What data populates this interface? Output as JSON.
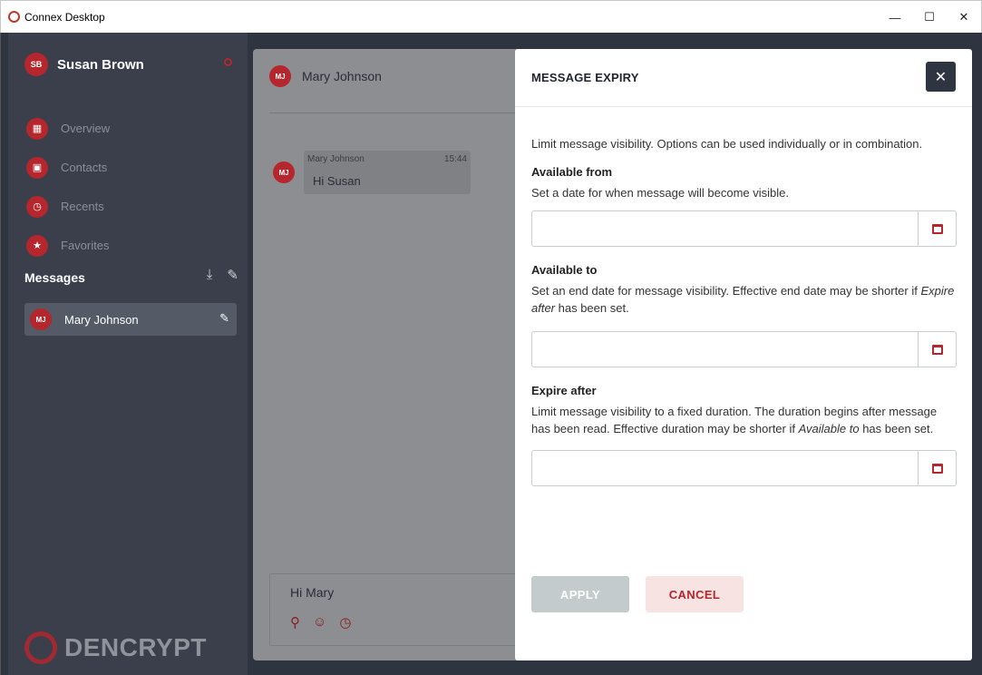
{
  "window": {
    "title": "Connex Desktop",
    "controls": {
      "minimize": "—",
      "maximize": "☐",
      "close": "✕"
    }
  },
  "sidebar": {
    "user": {
      "initials": "SB",
      "name": "Susan Brown"
    },
    "nav": [
      {
        "label": "Overview",
        "icon": "grid-icon",
        "glyph": "▦"
      },
      {
        "label": "Contacts",
        "icon": "contacts-icon",
        "glyph": "▣"
      },
      {
        "label": "Recents",
        "icon": "clock-icon",
        "glyph": "◷"
      },
      {
        "label": "Favorites",
        "icon": "star-icon",
        "glyph": "★"
      }
    ],
    "messages_title": "Messages",
    "threads": [
      {
        "initials": "MJ",
        "name": "Mary Johnson"
      }
    ],
    "logo_text": "DENCRYPT"
  },
  "chat": {
    "contact": {
      "initials": "MJ",
      "name": "Mary Johnson"
    },
    "messages": [
      {
        "sender": "Mary Johnson",
        "time": "15:44",
        "text": "Hi Susan"
      }
    ],
    "composer_text": "Hi Mary"
  },
  "modal": {
    "title": "MESSAGE EXPIRY",
    "close": "✕",
    "intro": "Limit message visibility. Options can be used individually or in combination.",
    "available_from": {
      "heading": "Available from",
      "description": "Set a date for when message will become visible.",
      "value": ""
    },
    "available_to": {
      "heading": "Available to",
      "description_pre": "Set an end date for message visibility. Effective end date may be shorter if ",
      "description_em": "Expire after",
      "description_post": " has been set.",
      "value": ""
    },
    "expire_after": {
      "heading": "Expire after",
      "description_pre": "Limit message visibility to a fixed duration. The duration begins after message has been read. Effective duration may be shorter if ",
      "description_em": "Available to",
      "description_post": " has been set.",
      "value": ""
    },
    "apply_label": "APPLY",
    "cancel_label": "CANCEL"
  },
  "colors": {
    "accent": "#b5262d",
    "sidebar": "#3a3f4b",
    "background": "#2f3441"
  }
}
